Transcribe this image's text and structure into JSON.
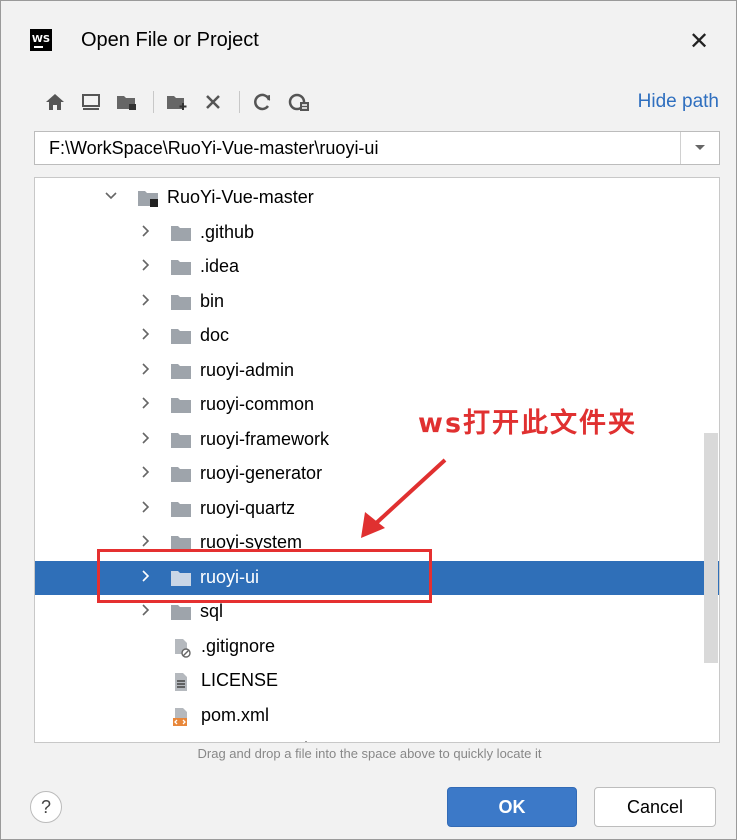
{
  "window": {
    "app_icon_text": "WS",
    "title": "Open File or Project",
    "close_glyph": "✕"
  },
  "toolbar": {
    "icons": [
      "home-icon",
      "desktop-icon",
      "project-folder-icon",
      "new-folder-icon",
      "delete-icon",
      "refresh-icon",
      "show-hidden-icon"
    ],
    "hide_path_label": "Hide path"
  },
  "path_field": {
    "value": "F:\\WorkSpace\\RuoYi-Vue-master\\ruoyi-ui"
  },
  "tree": {
    "rows": [
      {
        "label": "RuoYi-Vue-master",
        "type": "project-folder",
        "expanded": true,
        "selected": false
      },
      {
        "label": ".github",
        "type": "folder",
        "expanded": false,
        "selected": false
      },
      {
        "label": ".idea",
        "type": "folder",
        "expanded": false,
        "selected": false
      },
      {
        "label": "bin",
        "type": "folder",
        "expanded": false,
        "selected": false
      },
      {
        "label": "doc",
        "type": "folder",
        "expanded": false,
        "selected": false
      },
      {
        "label": "ruoyi-admin",
        "type": "folder",
        "expanded": false,
        "selected": false
      },
      {
        "label": "ruoyi-common",
        "type": "folder",
        "expanded": false,
        "selected": false
      },
      {
        "label": "ruoyi-framework",
        "type": "folder",
        "expanded": false,
        "selected": false
      },
      {
        "label": "ruoyi-generator",
        "type": "folder",
        "expanded": false,
        "selected": false
      },
      {
        "label": "ruoyi-quartz",
        "type": "folder",
        "expanded": false,
        "selected": false
      },
      {
        "label": "ruoyi-system",
        "type": "folder",
        "expanded": false,
        "selected": false
      },
      {
        "label": "ruoyi-ui",
        "type": "folder",
        "expanded": false,
        "selected": true
      },
      {
        "label": "sql",
        "type": "folder",
        "expanded": false,
        "selected": false
      },
      {
        "label": ".gitignore",
        "type": "ignore-file",
        "selected": false
      },
      {
        "label": "LICENSE",
        "type": "text-file",
        "selected": false
      },
      {
        "label": "pom.xml",
        "type": "xml-file",
        "selected": false
      },
      {
        "label": "README.md",
        "type": "md-file",
        "selected": false
      }
    ]
  },
  "hint_text": "Drag and drop a file into the space above to quickly locate it",
  "buttons": {
    "help_glyph": "?",
    "ok_label": "OK",
    "cancel_label": "Cancel"
  },
  "annotation": {
    "text": "ws打开此文件夹",
    "color": "#e03030"
  },
  "colors": {
    "selection": "#2f6fb8",
    "link": "#2f6fbf",
    "ok_button": "#3c79c8"
  }
}
